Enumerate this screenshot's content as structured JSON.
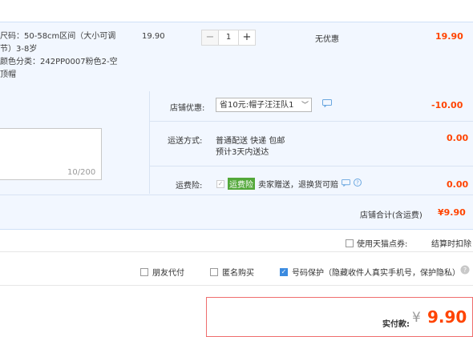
{
  "item": {
    "attrs": [
      "尺码：50-58cm区间（大小可调",
      "节）3-8岁",
      "颜色分类：242PP0007粉色2-空",
      "顶帽"
    ],
    "price": "19.90",
    "quantity": "1",
    "minus": "−",
    "plus": "+",
    "discount": "无优惠",
    "subtotal": "19.90"
  },
  "message": {
    "counter": "10/200"
  },
  "shop_promo": {
    "label": "店铺优惠:",
    "selected": "省10元:帽子汪汪队1",
    "amount": "-10.00"
  },
  "shipping": {
    "label": "运送方式:",
    "line1": "普通配送 快递 包邮",
    "line2": "预计3天内送达",
    "amount": "0.00"
  },
  "insurance": {
    "label": "运费险:",
    "badge": "运费险",
    "text": "卖家赠送，退换货可赔",
    "amount": "0.00"
  },
  "shop_total": {
    "label": "店铺合计(含运费)",
    "value": "¥9.90"
  },
  "points": {
    "label": "使用天猫点券:",
    "right": "结算时扣除"
  },
  "options": {
    "friend_pay": "朋友代付",
    "anonymous": "匿名购买",
    "privacy": "号码保护（隐藏收件人真实手机号，保护隐私）"
  },
  "payment": {
    "label": "实付款:",
    "currency": "¥",
    "amount": "9.90"
  },
  "colors": {
    "accent": "#ff4400",
    "blue": "#3b8be0"
  }
}
